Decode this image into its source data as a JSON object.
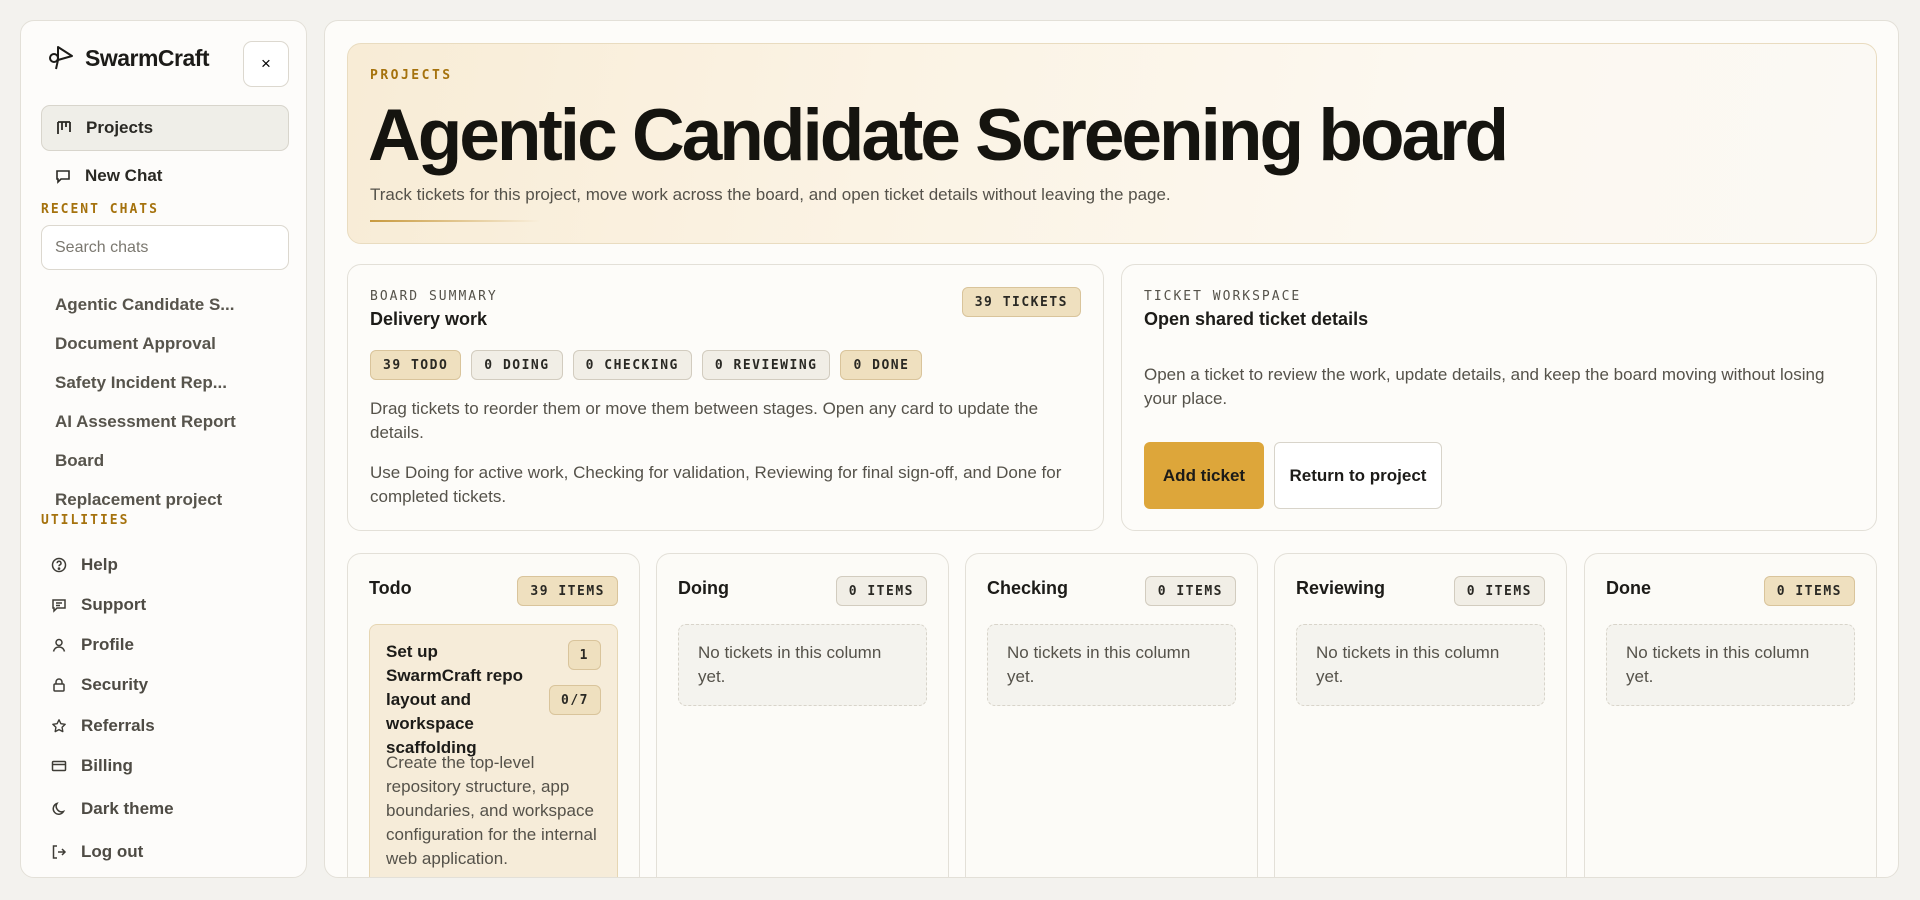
{
  "brand": {
    "name": "SwarmCraft"
  },
  "sidebar": {
    "close_label": "×",
    "nav": [
      {
        "label": "Projects",
        "icon": "kanban-icon"
      },
      {
        "label": "New Chat",
        "icon": "chat-icon"
      }
    ],
    "recent_label": "RECENT CHATS",
    "search_placeholder": "Search chats",
    "chats": [
      "Agentic Candidate S...",
      "Document Approval",
      "Safety Incident Rep...",
      "AI Assessment Report",
      "Board",
      "Replacement project"
    ],
    "utilities_label": "UTILITIES",
    "utilities": [
      {
        "label": "Help",
        "icon": "help-icon"
      },
      {
        "label": "Support",
        "icon": "support-icon"
      },
      {
        "label": "Profile",
        "icon": "user-icon"
      },
      {
        "label": "Security",
        "icon": "lock-icon"
      },
      {
        "label": "Referrals",
        "icon": "star-icon"
      },
      {
        "label": "Billing",
        "icon": "card-icon"
      },
      {
        "label": "Dark theme",
        "icon": "moon-icon"
      },
      {
        "label": "Log out",
        "icon": "logout-icon"
      }
    ]
  },
  "hero": {
    "kicker": "PROJECTS",
    "title": "Agentic Candidate Screening board",
    "description": "Track tickets for this project, move work across the board, and open ticket details without leaving the page."
  },
  "summary": {
    "kicker": "BOARD SUMMARY",
    "title": "Delivery work",
    "total_badge": "39 TICKETS",
    "stages": [
      "39 TODO",
      "0 DOING",
      "0 CHECKING",
      "0 REVIEWING",
      "0 DONE"
    ],
    "text1": "Drag tickets to reorder them or move them between stages. Open any card to update the details.",
    "text2": "Use Doing for active work, Checking for validation, Reviewing for final sign-off, and Done for completed tickets."
  },
  "workspace": {
    "kicker": "TICKET WORKSPACE",
    "title": "Open shared ticket details",
    "text": "Open a ticket to review the work, update details, and keep the board moving without losing your place.",
    "add_label": "Add ticket",
    "return_label": "Return to project"
  },
  "columns": [
    {
      "title": "Todo",
      "count": "39 ITEMS"
    },
    {
      "title": "Doing",
      "count": "0 ITEMS",
      "empty": "No tickets in this column yet."
    },
    {
      "title": "Checking",
      "count": "0 ITEMS",
      "empty": "No tickets in this column yet."
    },
    {
      "title": "Reviewing",
      "count": "0 ITEMS",
      "empty": "No tickets in this column yet."
    },
    {
      "title": "Done",
      "count": "0 ITEMS",
      "empty": "No tickets in this column yet."
    }
  ],
  "ticket": {
    "title": "Set up SwarmCraft repo layout and workspace scaffolding",
    "number": "1",
    "progress": "0/7",
    "description": "Create the top-level repository structure, app boundaries, and workspace configuration for the internal web application."
  },
  "colors": {
    "accent": "#dda63a",
    "kicker": "#a5720d",
    "background": "#f3f2ee"
  }
}
